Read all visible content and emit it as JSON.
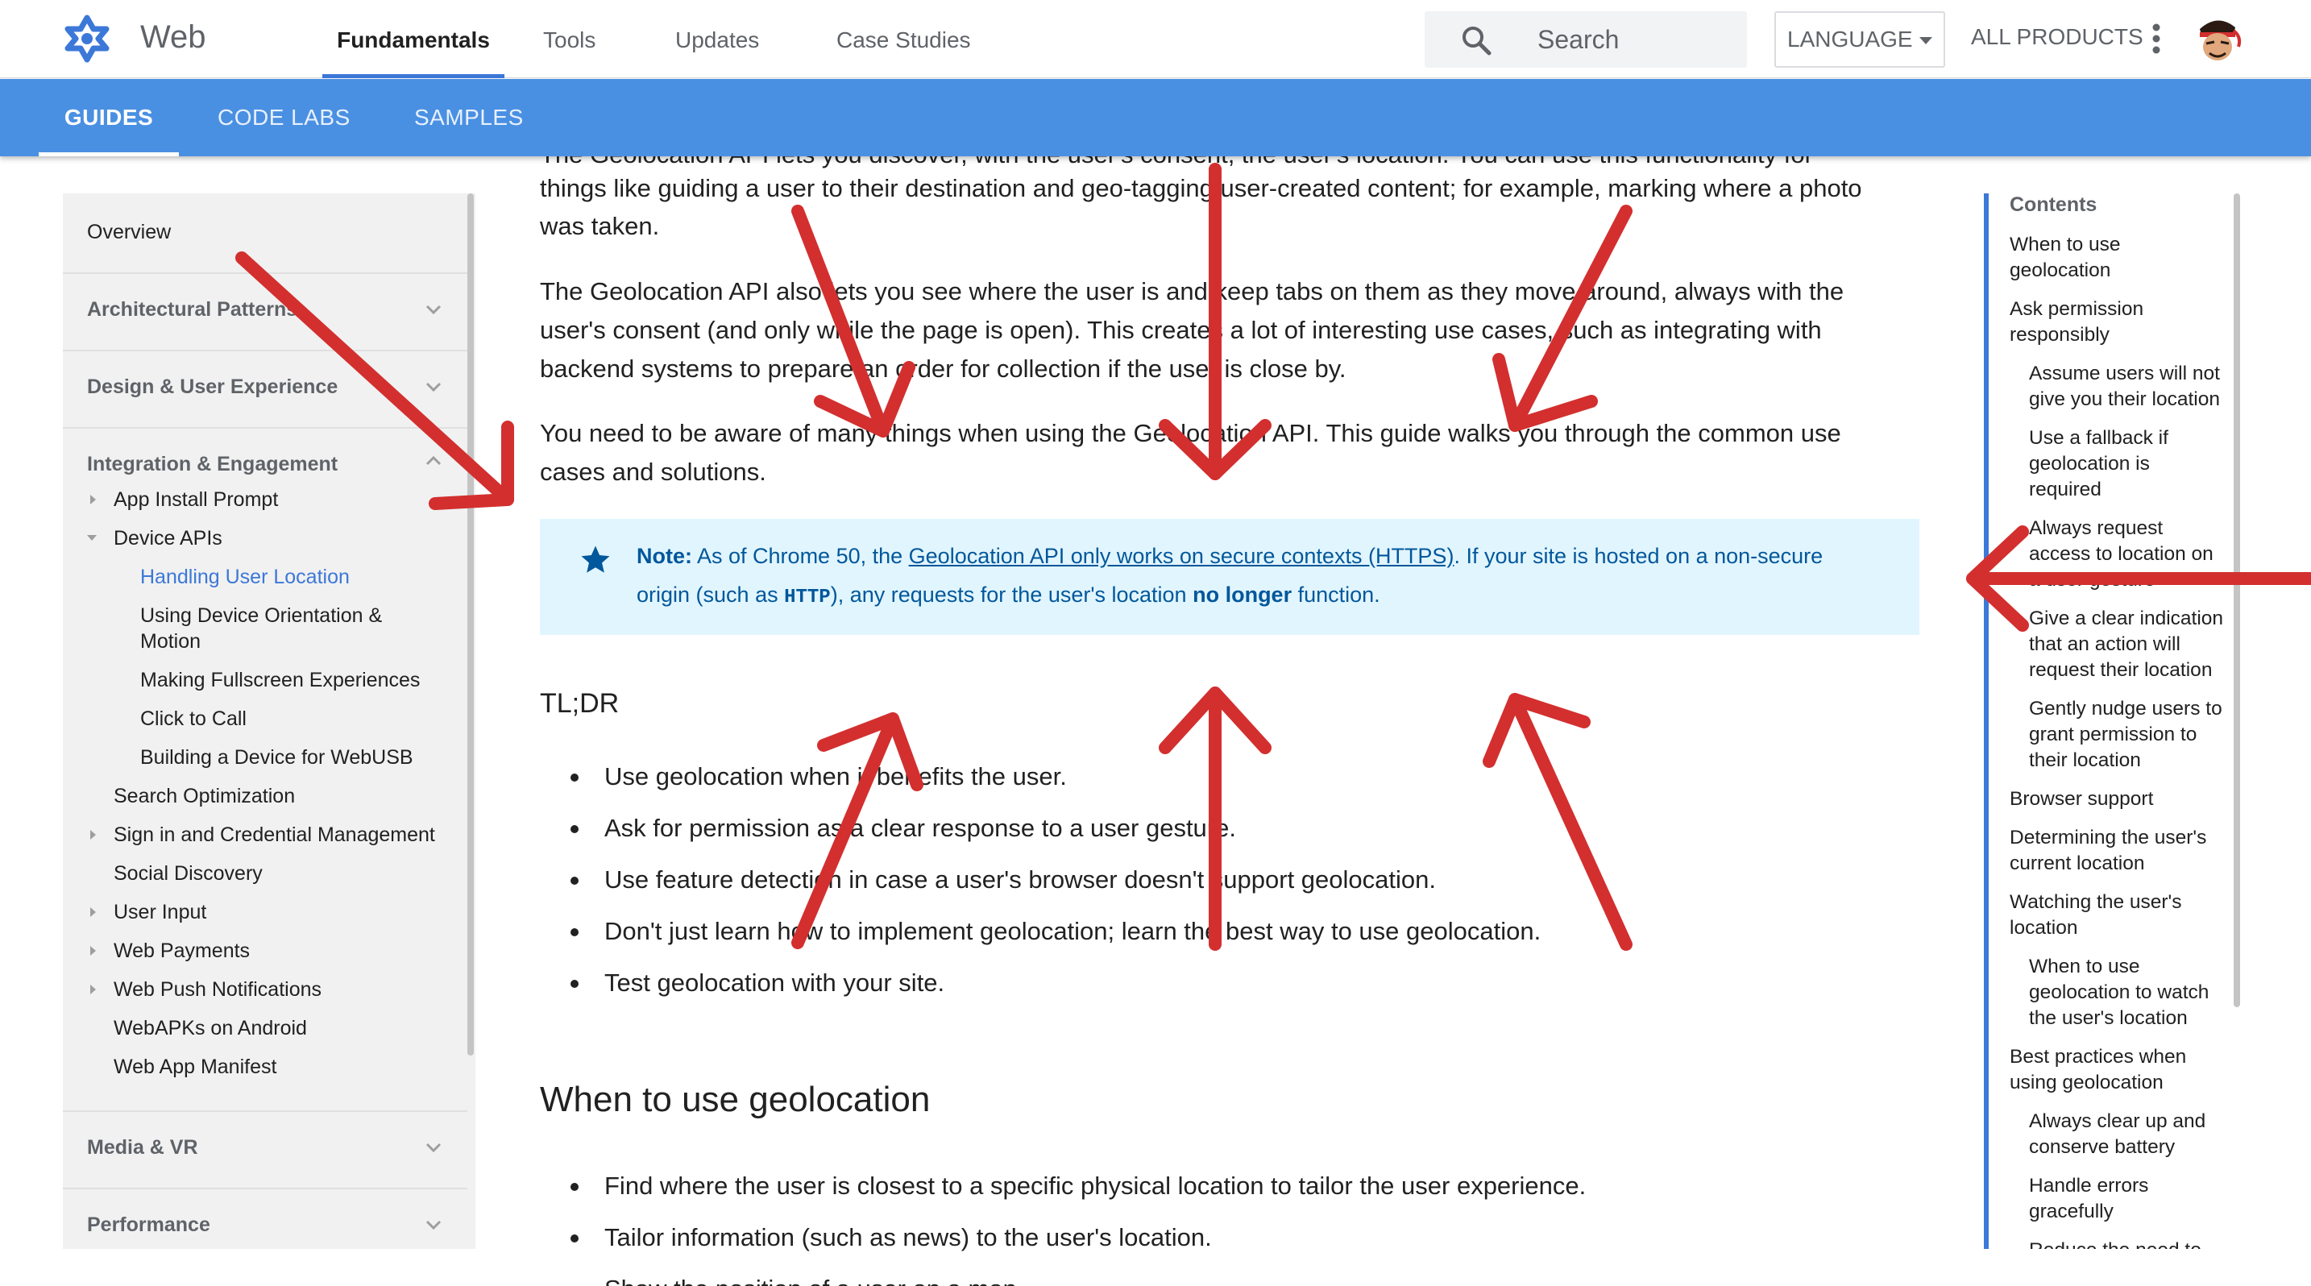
{
  "header": {
    "site_name": "Web",
    "tabs": [
      "Fundamentals",
      "Tools",
      "Updates",
      "Case Studies"
    ],
    "search_placeholder": "Search",
    "language_label": "LANGUAGE",
    "all_products_label": "ALL PRODUCTS"
  },
  "subnav": {
    "tabs": [
      "GUIDES",
      "CODE LABS",
      "SAMPLES"
    ]
  },
  "sidebar": {
    "sections": [
      "Overview",
      "Architectural Patterns",
      "Design & User Experience",
      "Integration & Engagement",
      "Media & VR",
      "Performance"
    ],
    "items": [
      "App Install Prompt",
      "Device APIs",
      "Handling User Location",
      "Using Device Orientation &",
      "Motion",
      "Making Fullscreen Experiences",
      "Click to Call",
      "Building a Device for WebUSB",
      "Search Optimization",
      "Sign in and Credential Management",
      "Social Discovery",
      "User Input",
      "Web Payments",
      "Web Push Notifications",
      "WebAPKs on Android",
      "Web App Manifest"
    ]
  },
  "content": {
    "para1_top": "The Geolocation API lets you discover, with the user's consent, the user's location. You can use this functionality for",
    "para1_l1": "things like guiding a user to their destination and geo-tagging user-created content; for example, marking where a photo",
    "para1_l2": "was taken.",
    "para2_l1": "The Geolocation API also lets you see where the user is and keep tabs on them as they move around, always with the",
    "para2_l2": "user's consent (and only while the page is open). This creates a lot of interesting use cases, such as integrating with",
    "para2_l3": "backend systems to prepare an order for collection if the user is close by.",
    "para3_l1": "You need to be aware of many things when using the Geolocation API. This guide walks you through the common use",
    "para3_l2": "cases and solutions.",
    "note": {
      "label": "Note:",
      "text_before": " As of Chrome 50, the ",
      "link": "Geolocation API only works on secure contexts (HTTPS)",
      "text_after": ". If your site is hosted on a non-secure",
      "line2_before": "origin (such as ",
      "code": "HTTP",
      "line2_mid": "), any requests for the user's location ",
      "bold": "no longer",
      "line2_after": " function."
    },
    "tldr_heading": "TL;DR",
    "tldr_items": [
      "Use geolocation when it benefits the user.",
      "Ask for permission as a clear response to a user gesture.",
      "Use feature detection in case a user's browser doesn't support geolocation.",
      "Don't just learn how to implement geolocation; learn the best way to use geolocation.",
      "Test geolocation with your site."
    ],
    "when_heading": "When to use geolocation",
    "when_items": [
      "Find where the user is closest to a specific physical location to tailor the user experience.",
      "Tailor information (such as news) to the user's location.",
      "Show the position of a user on a map."
    ]
  },
  "toc": {
    "title": "Contents",
    "items": [
      "When to use",
      "geolocation",
      "Ask permission",
      "responsibly",
      "Assume users will not",
      "give you their location",
      "Use a fallback if",
      "geolocation is",
      "required",
      "Always request",
      "access to location on",
      "a user gesture",
      "Give a clear indication",
      "that an action will",
      "request their location",
      "Gently nudge users to",
      "grant permission to",
      "their location",
      "Browser support",
      "Determining the user's",
      "current location",
      "Watching the user's",
      "location",
      "When to use",
      "geolocation to watch",
      "the user's location",
      "Best practices when",
      "using geolocation",
      "Always clear up and",
      "conserve battery",
      "Handle errors",
      "gracefully",
      "Reduce the need to"
    ]
  },
  "colors": {
    "accent": "#3c78d8",
    "subnav": "#4a90e2",
    "note_bg": "#e1f5fe",
    "note_text": "#01579b",
    "arrow": "#d32f2f"
  }
}
